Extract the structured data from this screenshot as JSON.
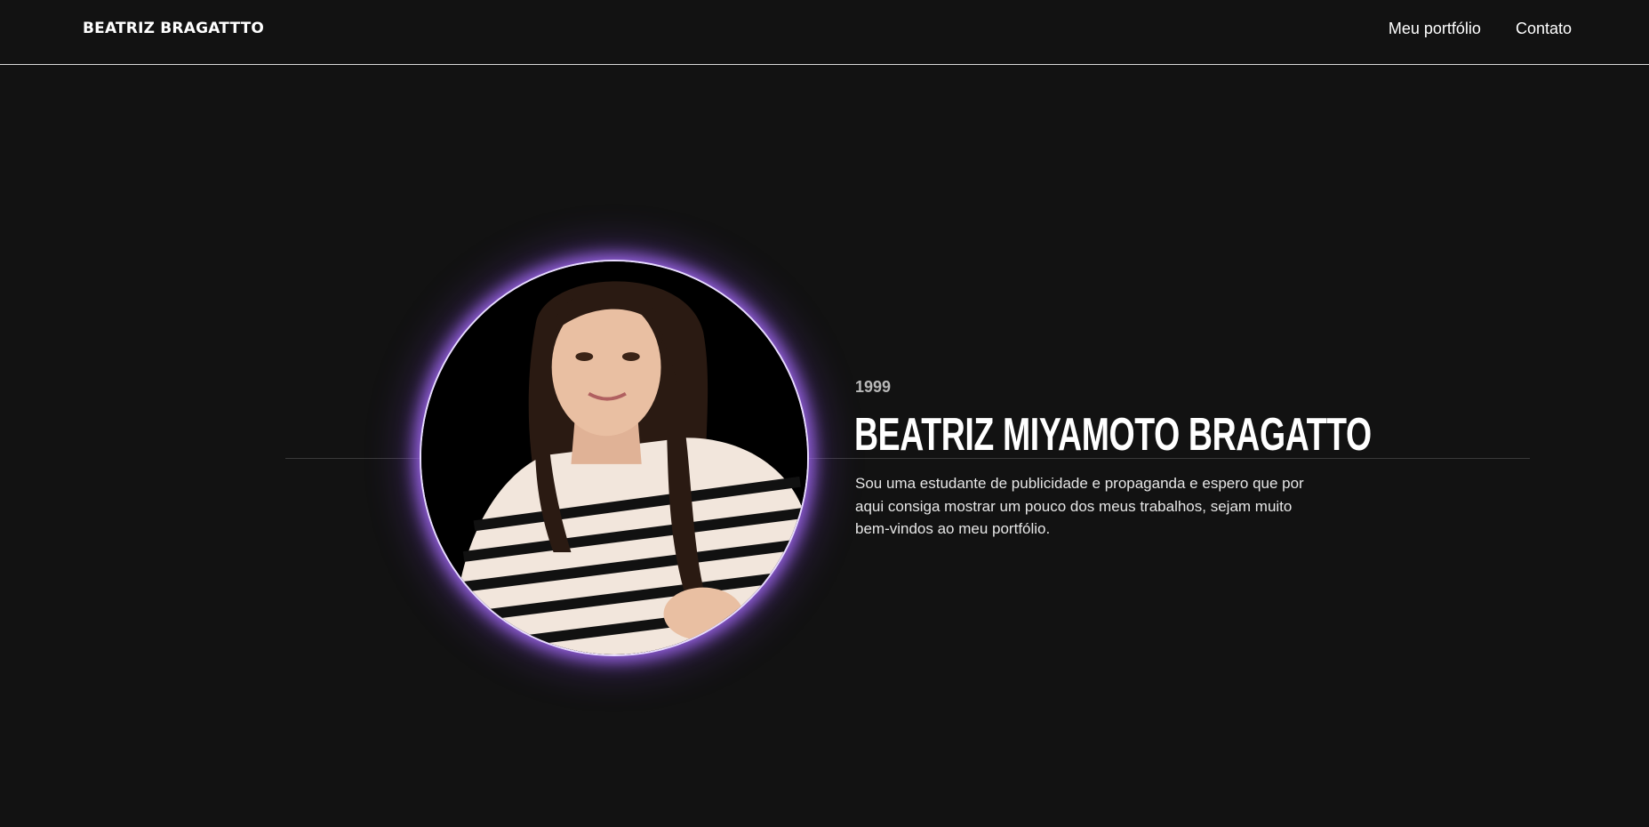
{
  "header": {
    "brand": "BEATRIZ BRAGATTTO",
    "nav": [
      {
        "label": "Meu portfólio"
      },
      {
        "label": "Contato"
      }
    ]
  },
  "hero": {
    "year": "1999",
    "name": "BEATRIZ MIYAMOTO BRAGATTO",
    "bio": "Sou uma estudante de publicidade e propaganda e espero que por aqui consiga mostrar um pouco dos meus trabalhos, sejam muito bem-vindos ao meu portfólio.",
    "photo_icon": "portrait-photo"
  },
  "colors": {
    "background": "#121212",
    "glow": "#a86eff",
    "text": "#ffffff"
  }
}
